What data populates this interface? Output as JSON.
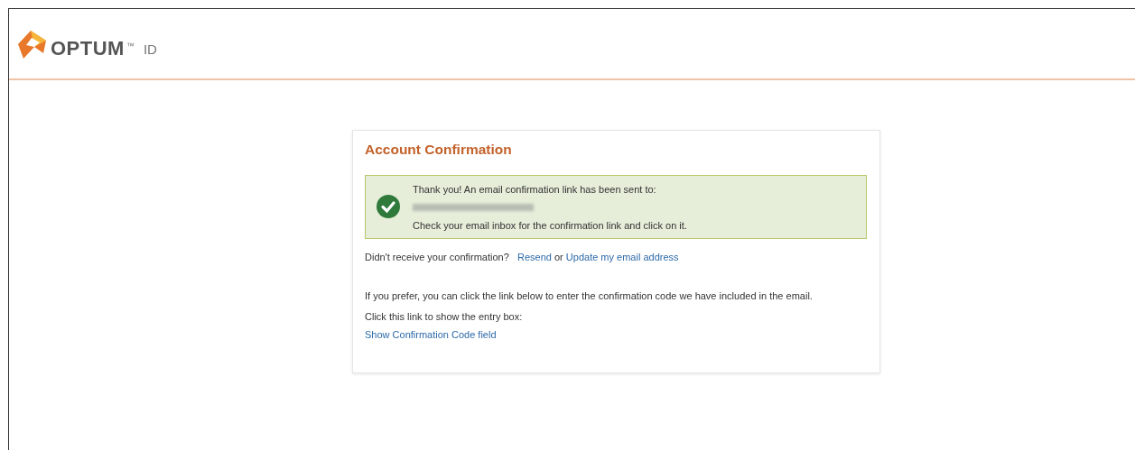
{
  "header": {
    "brand": "OPTUM",
    "trademark": "™",
    "product": "ID"
  },
  "card": {
    "title": "Account Confirmation",
    "notice": {
      "kind": "success",
      "line_1": "Thank you! An email confirmation link has been sent to:",
      "email_redacted": true,
      "line_2": "Check your email inbox for the confirmation link and click on it."
    },
    "resend": {
      "question": "Didn't receive your confirmation?",
      "resend_link": "Resend",
      "joiner": "or",
      "update_link": "Update my email address"
    },
    "prefer_text": "If you prefer, you can click the link below to enter the confirmation code we have included in the email.",
    "instruction": "Click this link to show the entry box:",
    "code_link": "Show Confirmation Code field"
  }
}
